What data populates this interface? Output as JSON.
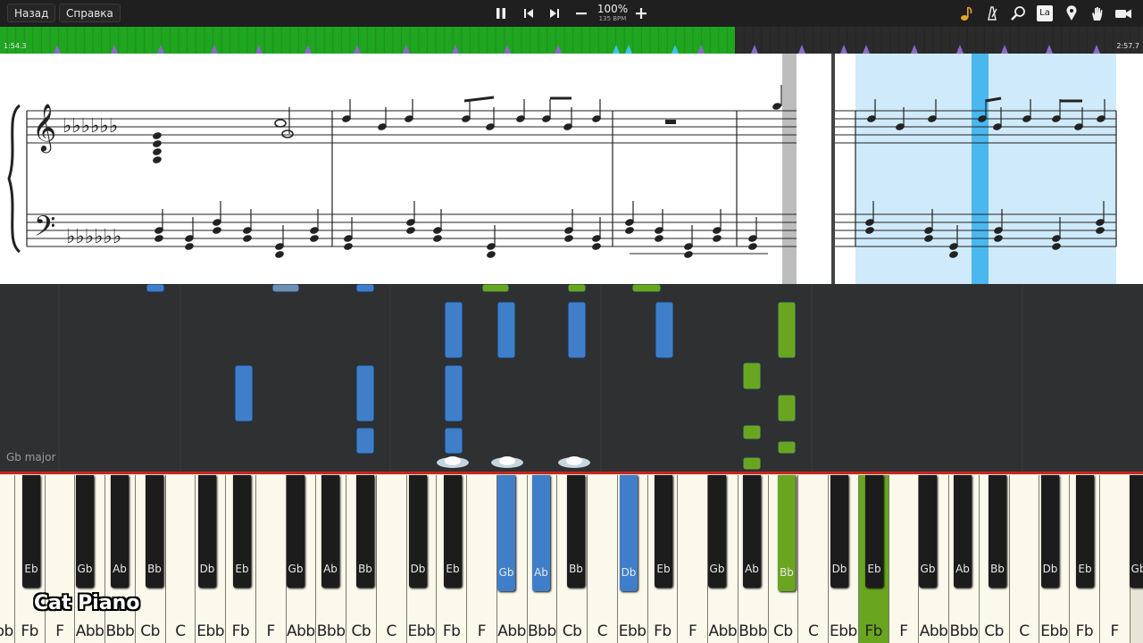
{
  "toolbar": {
    "back_label": "Назад",
    "help_label": "Справка",
    "zoom_label": "100%",
    "tempo_label": "135 BPM",
    "icons": [
      "play-pause-icon",
      "skip-back-icon",
      "skip-forward-icon",
      "zoom-out-icon",
      "zoom-in-icon",
      "note-icon",
      "metronome-icon",
      "search-icon",
      "note-name-icon",
      "location-pin-icon",
      "hand-icon",
      "camera-icon"
    ],
    "note_name_badge": "La"
  },
  "timeline": {
    "start_time": "1:54.3",
    "end_time": "2:57.7",
    "progress": 0.643
  },
  "roll": {
    "key_signature": "Gb major"
  },
  "keyboard": {
    "white_labels": [
      "Ebb",
      "Fb",
      "F",
      "Abb",
      "Bbb",
      "Cb",
      "C",
      "Ebb",
      "Fb",
      "F",
      "Abb",
      "Bbb",
      "Cb",
      "C",
      "Ebb",
      "Fb",
      "F",
      "Abb",
      "Bbb",
      "Cb",
      "C",
      "Ebb",
      "Fb",
      "F",
      "Abb",
      "Bbb",
      "Cb",
      "C",
      "Ebb",
      "Fb",
      "F",
      "Abb",
      "Bbb",
      "Cb",
      "C",
      "Ebb",
      "Fb",
      "F"
    ],
    "black_labels": [
      "Eb",
      "Gb",
      "Ab",
      "Bb",
      "Db",
      "Eb",
      "Gb",
      "Ab",
      "Bb",
      "Db",
      "Eb",
      "Gb",
      "Ab",
      "Bb",
      "Db",
      "Eb",
      "Gb",
      "Ab",
      "Bb",
      "Db",
      "Eb",
      "Gb",
      "Ab",
      "Bb",
      "Db",
      "Eb",
      "Gb"
    ]
  },
  "colors": {
    "right_hand": "#3f7fc9",
    "left_hand": "#6aa520",
    "timeline_played": "#1fa51f",
    "current_measure": "#cfeafa"
  },
  "brand": "Cat Piano"
}
